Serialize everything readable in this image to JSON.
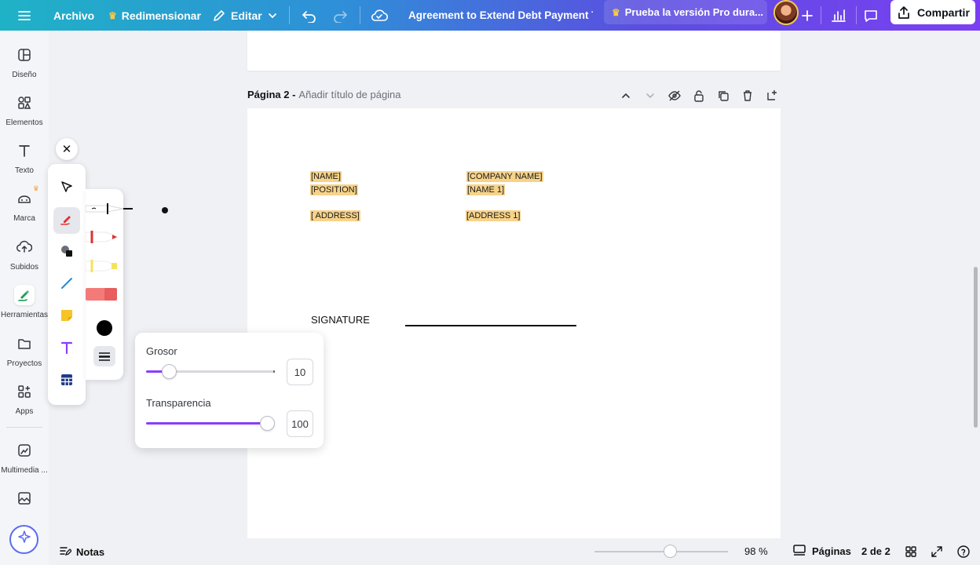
{
  "topbar": {
    "file_label": "Archivo",
    "resize_label": "Redimensionar",
    "edit_label": "Editar",
    "doc_title": "Agreement to Extend Debt Payment T...",
    "pro_label": "Prueba la versión Pro dura...",
    "share_label": "Compartir"
  },
  "sidebar": {
    "items": [
      {
        "label": "Diseño",
        "icon": "layout-icon"
      },
      {
        "label": "Elementos",
        "icon": "elements-icon"
      },
      {
        "label": "Texto",
        "icon": "text-icon"
      },
      {
        "label": "Marca",
        "icon": "brand-icon"
      },
      {
        "label": "Subidos",
        "icon": "upload-cloud-icon"
      },
      {
        "label": "Herramientas",
        "icon": "draw-tool-icon"
      },
      {
        "label": "Proyectos",
        "icon": "folder-icon"
      },
      {
        "label": "Apps",
        "icon": "apps-icon"
      },
      {
        "label": "Multimedia ...",
        "icon": "media-icon"
      }
    ]
  },
  "page2": {
    "title_prefix": "Página 2 -",
    "title_placeholder": "Añadir título de página",
    "fields": {
      "name": "[NAME]",
      "position": "[POSITION]",
      "address": "[ ADDRESS]",
      "company": "[COMPANY NAME]",
      "name1": "[NAME 1]",
      "address1": "[ADDRESS 1]"
    },
    "signature_label": "SIGNATURE"
  },
  "stroke_popover": {
    "weight_label": "Grosor",
    "weight_value": "10",
    "weight_fraction": 0.14,
    "transparency_label": "Transparencia",
    "transparency_value": "100",
    "transparency_fraction": 1.0
  },
  "bottombar": {
    "notes_label": "Notas",
    "zoom_value": "98 %",
    "pages_label": "Páginas",
    "page_count": "2 de 2"
  },
  "colors": {
    "accent": "#8b3dff",
    "highlight": "#f7d38a",
    "pen_red": "#e03131",
    "marker_yellow": "#f5e35b",
    "highlighter_pink": "#f47a7a"
  }
}
